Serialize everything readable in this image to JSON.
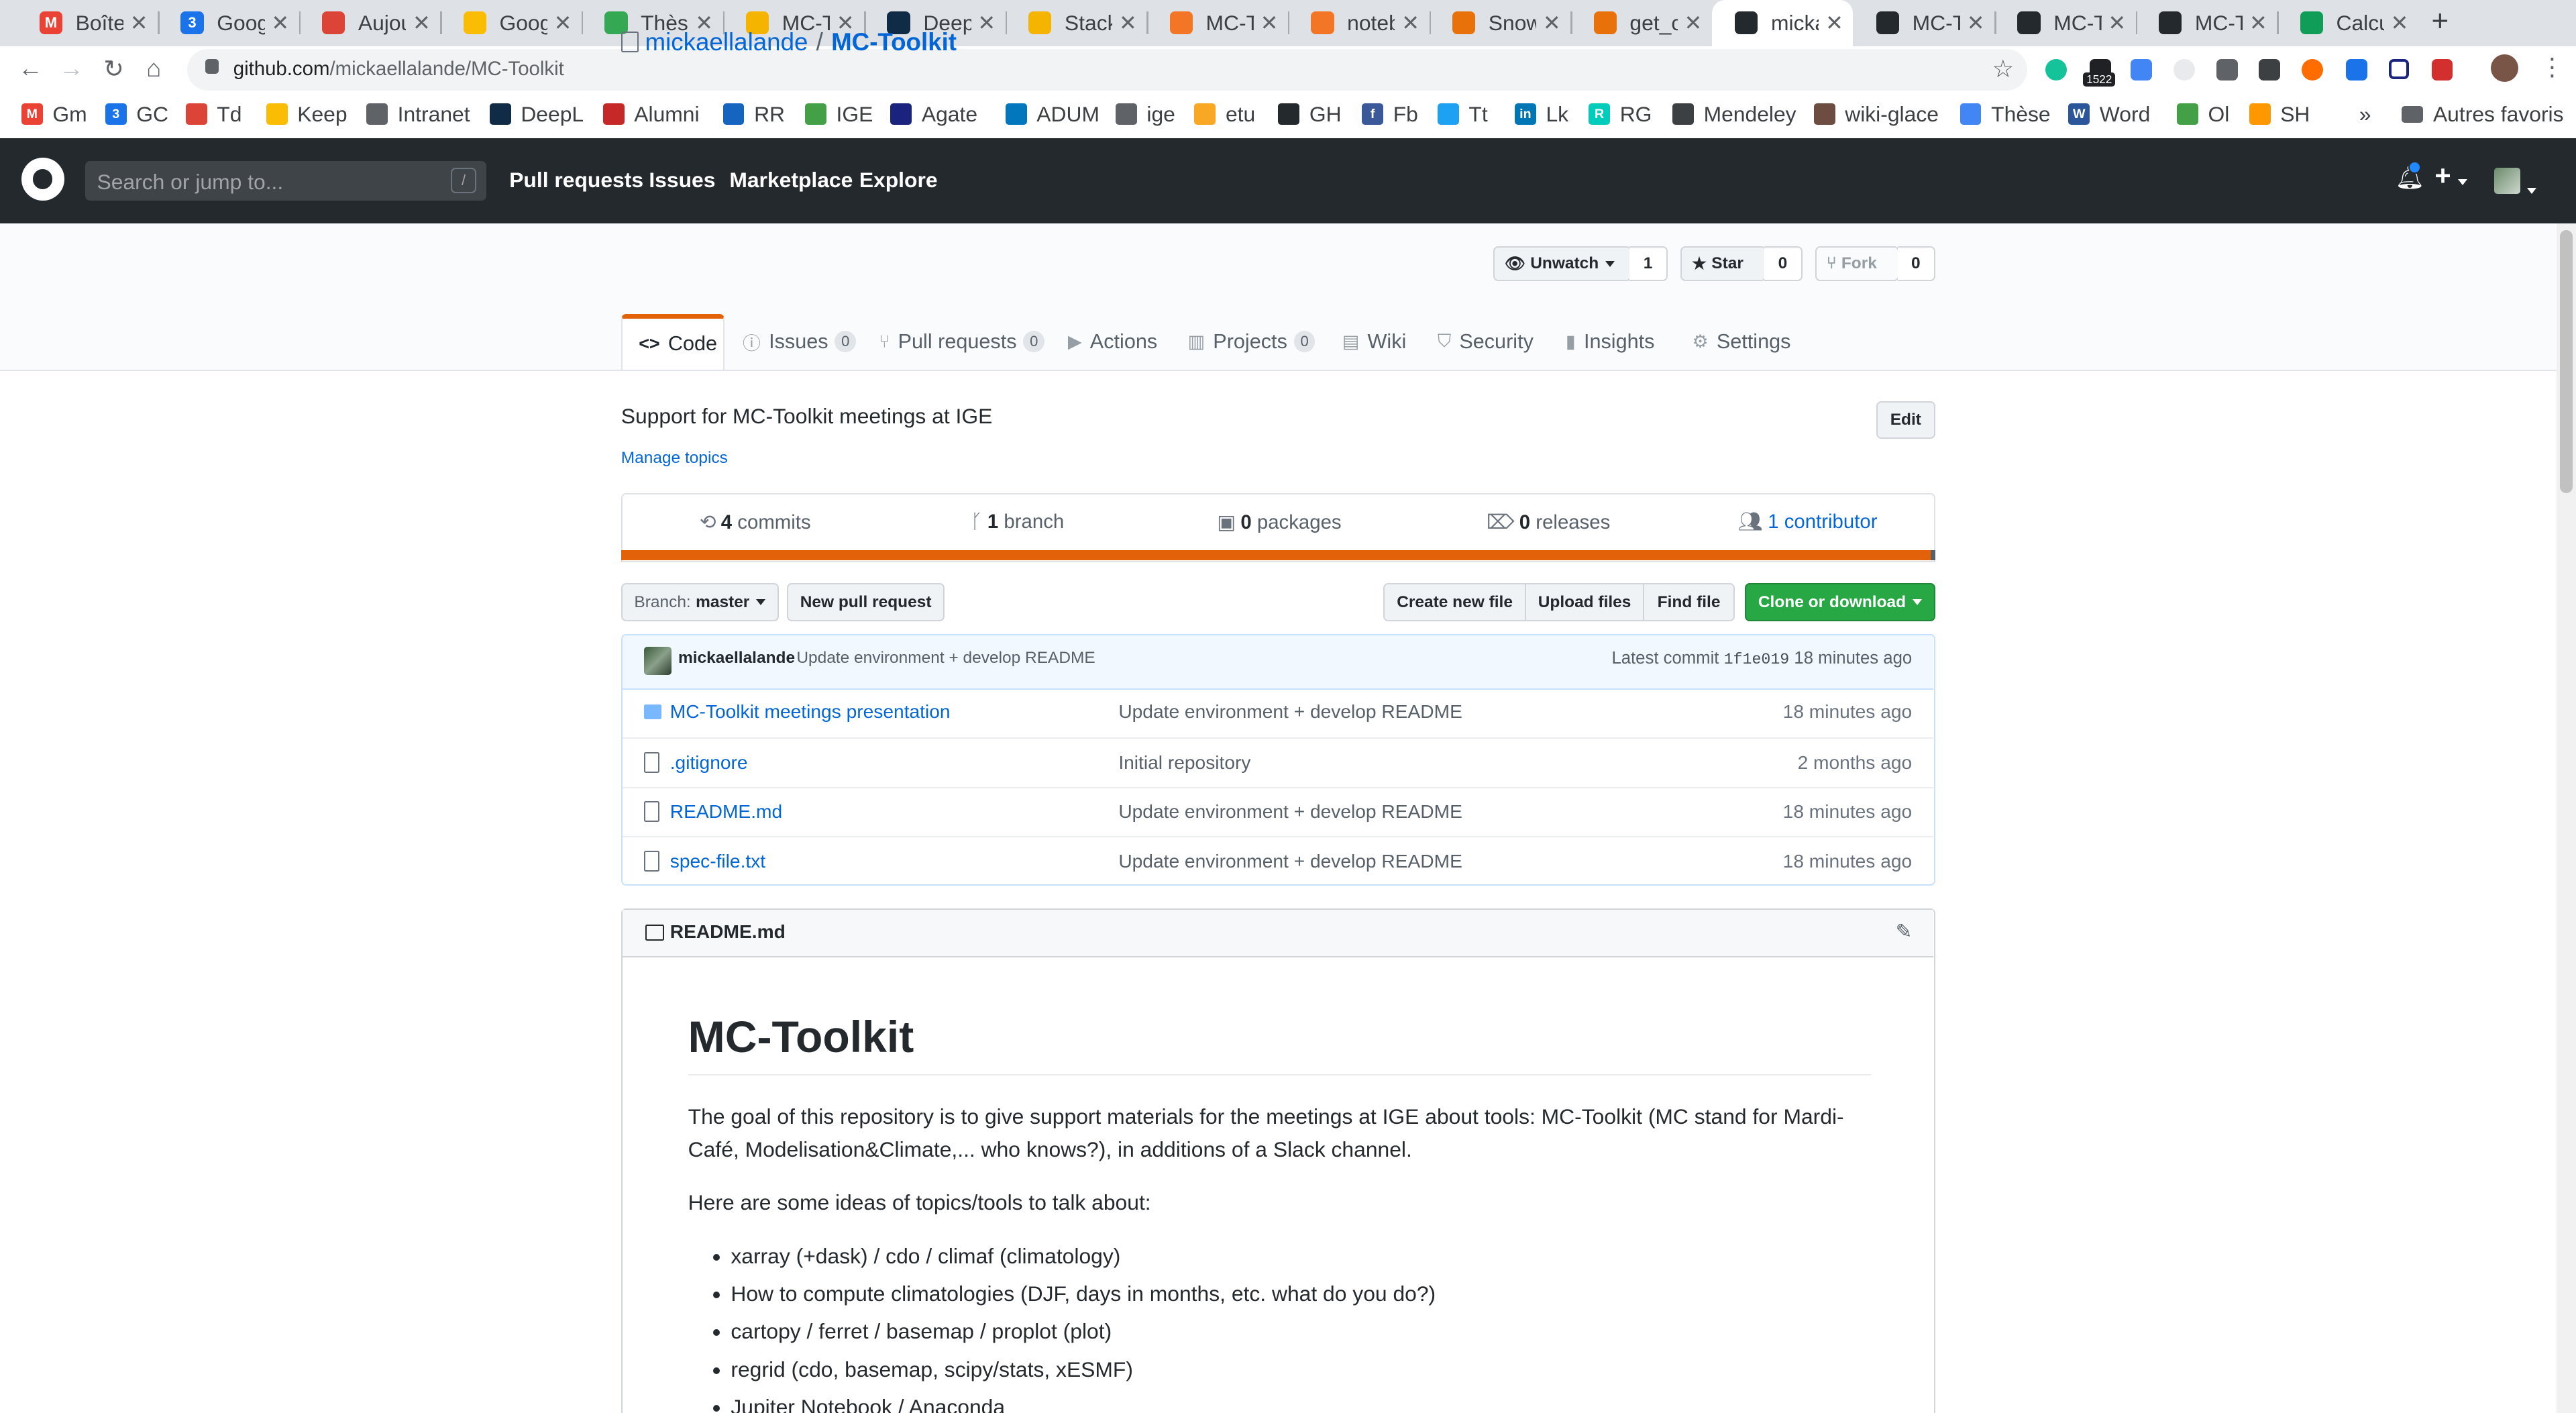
{
  "browser": {
    "tabs": [
      {
        "title": "Boîte",
        "color": "#ea4335",
        "glyph": "M"
      },
      {
        "title": "Googl",
        "color": "#1a73e8",
        "glyph": "3"
      },
      {
        "title": "Aujou",
        "color": "#db4437",
        "glyph": ""
      },
      {
        "title": "Googl",
        "color": "#fbbc04",
        "glyph": ""
      },
      {
        "title": "Thèse",
        "color": "#34a853",
        "glyph": ""
      },
      {
        "title": "MC-T",
        "color": "#f4b400",
        "glyph": ""
      },
      {
        "title": "Deepl",
        "color": "#0f2b46",
        "glyph": ""
      },
      {
        "title": "Stack",
        "color": "#f4b400",
        "glyph": ""
      },
      {
        "title": "MC-T",
        "color": "#f37626",
        "glyph": ""
      },
      {
        "title": "noteb",
        "color": "#f37626",
        "glyph": ""
      },
      {
        "title": "Snow",
        "color": "#e8710a",
        "glyph": ""
      },
      {
        "title": "get_cl",
        "color": "#e8710a",
        "glyph": ""
      },
      {
        "title": "micka",
        "color": "#24292e",
        "glyph": ""
      },
      {
        "title": "MC-T",
        "color": "#24292e",
        "glyph": ""
      },
      {
        "title": "MC-T",
        "color": "#24292e",
        "glyph": ""
      },
      {
        "title": "MC-T",
        "color": "#24292e",
        "glyph": ""
      },
      {
        "title": "Calcul",
        "color": "#0f9d58",
        "glyph": ""
      }
    ],
    "url_host": "github.com",
    "url_path": "/mickaellalande/MC-Toolkit",
    "extension_badge": "1522",
    "bookmarks": [
      {
        "label": "Gm",
        "color": "#ea4335",
        "glyph": "M"
      },
      {
        "label": "GC",
        "color": "#1a73e8",
        "glyph": "3"
      },
      {
        "label": "Td",
        "color": "#db4437",
        "glyph": ""
      },
      {
        "label": "Keep",
        "color": "#fbbc04",
        "glyph": ""
      },
      {
        "label": "Intranet",
        "color": "#5f6368",
        "glyph": ""
      },
      {
        "label": "DeepL",
        "color": "#0f2b46",
        "glyph": ""
      },
      {
        "label": "Alumni",
        "color": "#c62828",
        "glyph": ""
      },
      {
        "label": "RR",
        "color": "#1565c0",
        "glyph": ""
      },
      {
        "label": "IGE",
        "color": "#43a047",
        "glyph": ""
      },
      {
        "label": "Agate",
        "color": "#1a237e",
        "glyph": ""
      },
      {
        "label": "ADUM",
        "color": "#0277bd",
        "glyph": ""
      },
      {
        "label": "ige",
        "color": "#5f6368",
        "glyph": ""
      },
      {
        "label": "etu",
        "color": "#f9a825",
        "glyph": ""
      },
      {
        "label": "GH",
        "color": "#24292e",
        "glyph": ""
      },
      {
        "label": "Fb",
        "color": "#3b5998",
        "glyph": "f"
      },
      {
        "label": "Tt",
        "color": "#1da1f2",
        "glyph": ""
      },
      {
        "label": "Lk",
        "color": "#0077b5",
        "glyph": "in"
      },
      {
        "label": "RG",
        "color": "#00ccbb",
        "glyph": "R"
      },
      {
        "label": "Mendeley",
        "color": "#3c4043",
        "glyph": ""
      },
      {
        "label": "wiki-glace",
        "color": "#6d4c41",
        "glyph": ""
      },
      {
        "label": "Thèse",
        "color": "#4285f4",
        "glyph": ""
      },
      {
        "label": "Word",
        "color": "#2b579a",
        "glyph": "W"
      },
      {
        "label": "Ol",
        "color": "#43a047",
        "glyph": ""
      },
      {
        "label": "SH",
        "color": "#ff9800",
        "glyph": ""
      }
    ],
    "bookmarks_overflow": "»",
    "other_bookmarks": "Autres favoris"
  },
  "gh_header": {
    "search_placeholder": "Search or jump to...",
    "search_shortcut": "/",
    "nav": [
      "Pull requests",
      "Issues",
      "Marketplace",
      "Explore"
    ],
    "plus": "+",
    "notification_icon": "bell-icon"
  },
  "repo": {
    "owner": "mickaellalande",
    "separator": "/",
    "name": "MC-Toolkit",
    "unwatch_label": "Unwatch",
    "watch_count": "1",
    "star_label": "Star",
    "star_count": "0",
    "fork_label": "Fork",
    "fork_count": "0",
    "tabs": [
      {
        "label": "Code",
        "count": null,
        "icon": "code-icon"
      },
      {
        "label": "Issues",
        "count": "0",
        "icon": "issue-icon"
      },
      {
        "label": "Pull requests",
        "count": "0",
        "icon": "pr-icon"
      },
      {
        "label": "Actions",
        "count": null,
        "icon": "play-icon"
      },
      {
        "label": "Projects",
        "count": "0",
        "icon": "project-icon"
      },
      {
        "label": "Wiki",
        "count": null,
        "icon": "book-icon"
      },
      {
        "label": "Security",
        "count": null,
        "icon": "shield-icon"
      },
      {
        "label": "Insights",
        "count": null,
        "icon": "graph-icon"
      },
      {
        "label": "Settings",
        "count": null,
        "icon": "gear-icon"
      }
    ],
    "description": "Support for MC-Toolkit meetings at IGE",
    "edit_label": "Edit",
    "manage_topics": "Manage topics",
    "summary": {
      "commits_num": "4",
      "commits_label": "commits",
      "branches_num": "1",
      "branches_label": "branch",
      "packages_num": "0",
      "packages_label": "packages",
      "releases_num": "0",
      "releases_label": "releases",
      "contributors_label": "1 contributor"
    },
    "branch_prefix": "Branch:",
    "branch_name": "master",
    "new_pr_label": "New pull request",
    "create_file_label": "Create new file",
    "upload_label": "Upload files",
    "find_file_label": "Find file",
    "clone_label": "Clone or download",
    "latest_commit": {
      "author": "mickaellalande",
      "message": "Update environment + develop README",
      "prefix": "Latest commit",
      "sha": "1f1e019",
      "age": "18 minutes ago"
    },
    "files": [
      {
        "type": "dir",
        "name": "MC-Toolkit meetings presentation",
        "message": "Update environment + develop README",
        "age": "18 minutes ago"
      },
      {
        "type": "file",
        "name": ".gitignore",
        "message": "Initial repository",
        "age": "2 months ago"
      },
      {
        "type": "file",
        "name": "README.md",
        "message": "Update environment + develop README",
        "age": "18 minutes ago"
      },
      {
        "type": "file",
        "name": "spec-file.txt",
        "message": "Update environment + develop README",
        "age": "18 minutes ago"
      }
    ]
  },
  "readme": {
    "filename": "README.md",
    "h1": "MC-Toolkit",
    "para1": "The goal of this repository is to give support materials for the meetings at IGE about tools: MC-Toolkit (MC stand for Mardi-Café, Modelisation&Climate,... who knows?), in additions of a Slack channel.",
    "para2": "Here are some ideas of topics/tools to talk about:",
    "list": [
      "xarray (+dask) / cdo / climaf (climatology)",
      "How to compute climatologies (DJF, days in months, etc. what do you do?)",
      "cartopy / ferret / basemap / proplot (plot)",
      "regrid (cdo, basemap, scipy/stats, xESMF)",
      "Jupiter Notebook / Anaconda"
    ]
  },
  "colors": {
    "gh_header_bg": "#24292e",
    "link": "#0366d6",
    "accent_orange": "#e36209",
    "green_button": "#28a745"
  }
}
